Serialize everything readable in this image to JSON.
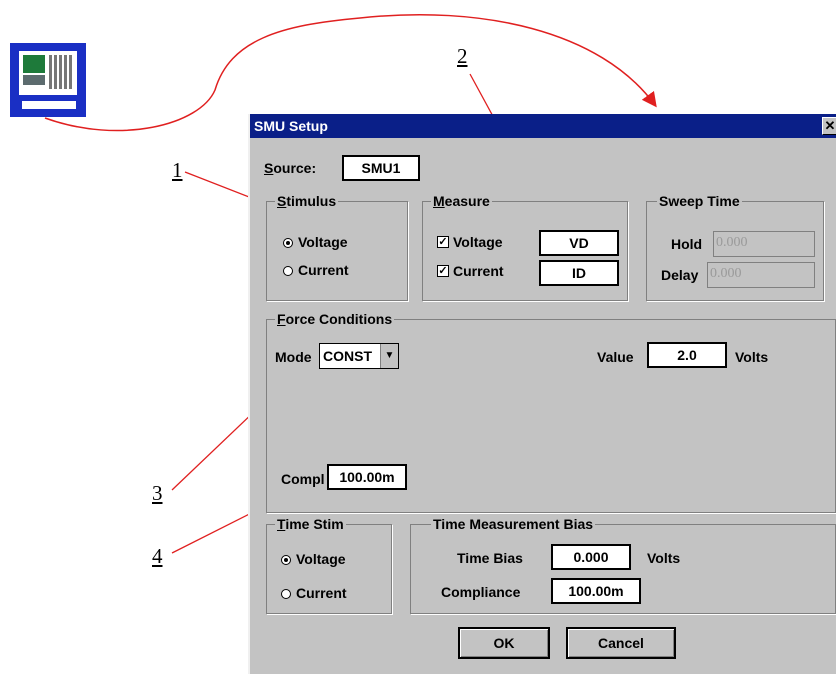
{
  "callouts": [
    "1",
    "2",
    "3",
    "4"
  ],
  "arrow_color": "#e02020",
  "dialog": {
    "title": "SMU Setup",
    "close_glyph": "✕",
    "source": {
      "label": "Source:",
      "value": "SMU1"
    },
    "stimulus": {
      "legend": "Stimulus",
      "options": [
        "Voltage",
        "Current"
      ],
      "selected": "Voltage"
    },
    "measure": {
      "legend": "Measure",
      "rows": [
        {
          "label": "Voltage",
          "checked": true,
          "value": "VD"
        },
        {
          "label": "Current",
          "checked": true,
          "value": "ID"
        }
      ]
    },
    "sweep_time": {
      "legend": "Sweep Time",
      "hold_label": "Hold",
      "hold_value": "0.000",
      "delay_label": "Delay",
      "delay_value": "0.000"
    },
    "force": {
      "legend": "Force Conditions",
      "mode_label": "Mode",
      "mode_value": "CONST",
      "value_label": "Value",
      "value": "2.0",
      "unit": "Volts",
      "compl_label": "Compl",
      "compl_value": "100.00m"
    },
    "time_stim": {
      "legend": "Time Stim",
      "options": [
        "Voltage",
        "Current"
      ],
      "selected": "Voltage"
    },
    "time_bias": {
      "legend": "Time Measurement Bias",
      "bias_label": "Time Bias",
      "bias_value": "0.000",
      "bias_unit": "Volts",
      "compliance_label": "Compliance",
      "compliance_value": "100.00m"
    },
    "ok_label": "OK",
    "cancel_label": "Cancel"
  }
}
